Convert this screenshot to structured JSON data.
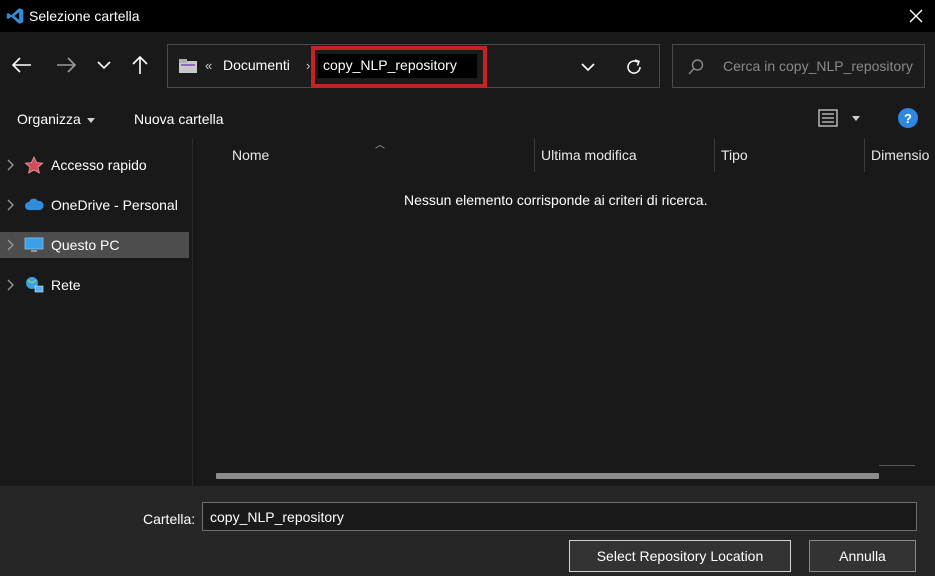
{
  "window": {
    "title": "Selezione cartella",
    "close_icon": "close-icon"
  },
  "nav_buttons": [
    "back-arrow-icon",
    "forward-arrow-icon",
    "recent-locations-chevron-icon",
    "up-arrow-icon"
  ],
  "address": {
    "overflow_glyph": "«",
    "breadcrumb": [
      "Documenti"
    ],
    "separator_glyph": "›",
    "editing_value": "copy_NLP_repository",
    "highlight_color": "#c42323"
  },
  "search": {
    "placeholder": "Cerca in copy_NLP_repository"
  },
  "command_bar": {
    "organize_label": "Organizza",
    "new_folder_label": "Nuova cartella",
    "help_label": "?"
  },
  "nav_pane": {
    "items": [
      {
        "label": "Accesso rapido",
        "icon": "star-icon"
      },
      {
        "label": "OneDrive - Personal",
        "icon": "cloud-icon"
      },
      {
        "label": "Questo PC",
        "icon": "computer-icon",
        "selected": true
      },
      {
        "label": "Rete",
        "icon": "network-icon"
      }
    ]
  },
  "columns": [
    "Nome",
    "Ultima modifica",
    "Tipo",
    "Dimensio"
  ],
  "content": {
    "empty_message": "Nessun elemento corrisponde ai criteri di ricerca."
  },
  "bottom": {
    "folder_label": "Cartella:",
    "folder_value": "copy_NLP_repository",
    "select_button": "Select Repository Location",
    "cancel_button": "Annulla"
  },
  "colors": {
    "background": "#191919",
    "titlebar": "#000000",
    "accent_blue": "#2e86de",
    "selected_item": "#4d4d4d"
  }
}
